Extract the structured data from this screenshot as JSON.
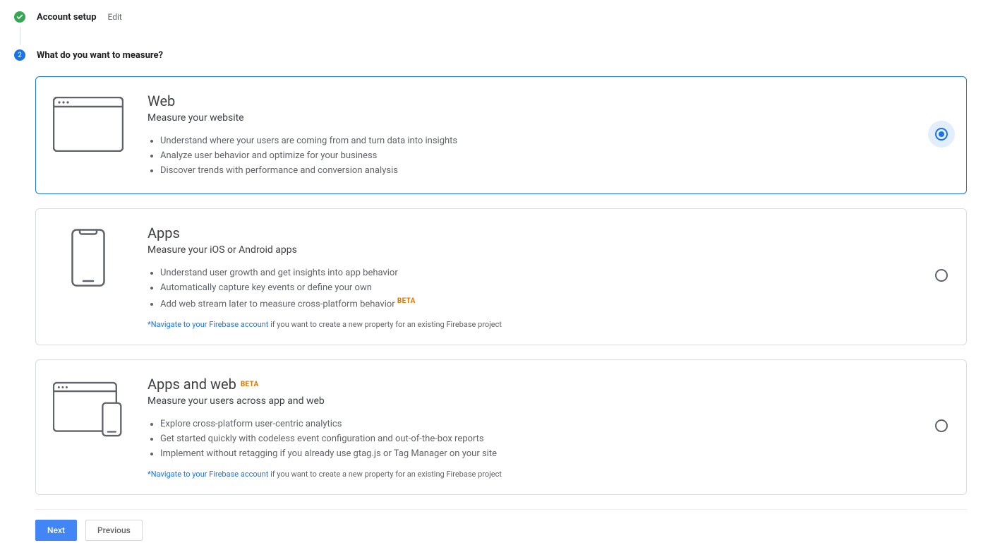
{
  "steps": {
    "done": {
      "title": "Account setup",
      "edit": "Edit"
    },
    "current": {
      "number": "2",
      "title": "What do you want to measure?"
    }
  },
  "options": [
    {
      "id": "web",
      "title": "Web",
      "subtitle": "Measure your website",
      "bullets": [
        "Understand where your users are coming from and turn data into insights",
        "Analyze user behavior and optimize for your business",
        "Discover trends with performance and conversion analysis"
      ],
      "beta": false,
      "selected": true,
      "footnote": null
    },
    {
      "id": "apps",
      "title": "Apps",
      "subtitle": "Measure your iOS or Android apps",
      "bullets": [
        "Understand user growth and get insights into app behavior",
        "Automatically capture key events or define your own",
        "Add web stream later to measure cross-platform behavior"
      ],
      "bullet_beta_index": 2,
      "beta": false,
      "selected": false,
      "footnote": {
        "link": "*Navigate to your Firebase account",
        "rest": " if you want to create a new property for an existing Firebase project"
      }
    },
    {
      "id": "apps-web",
      "title": "Apps and web",
      "subtitle": "Measure your users across app and web",
      "bullets": [
        "Explore cross-platform user-centric analytics",
        "Get started quickly with codeless event configuration and out-of-the-box reports",
        "Implement without retagging if you already use gtag.js or Tag Manager on your site"
      ],
      "beta": true,
      "selected": false,
      "footnote": {
        "link": "*Navigate to your Firebase account",
        "rest": " if you want to create a new property for an existing Firebase project"
      }
    }
  ],
  "labels": {
    "beta": "BETA"
  },
  "buttons": {
    "next": "Next",
    "previous": "Previous"
  }
}
